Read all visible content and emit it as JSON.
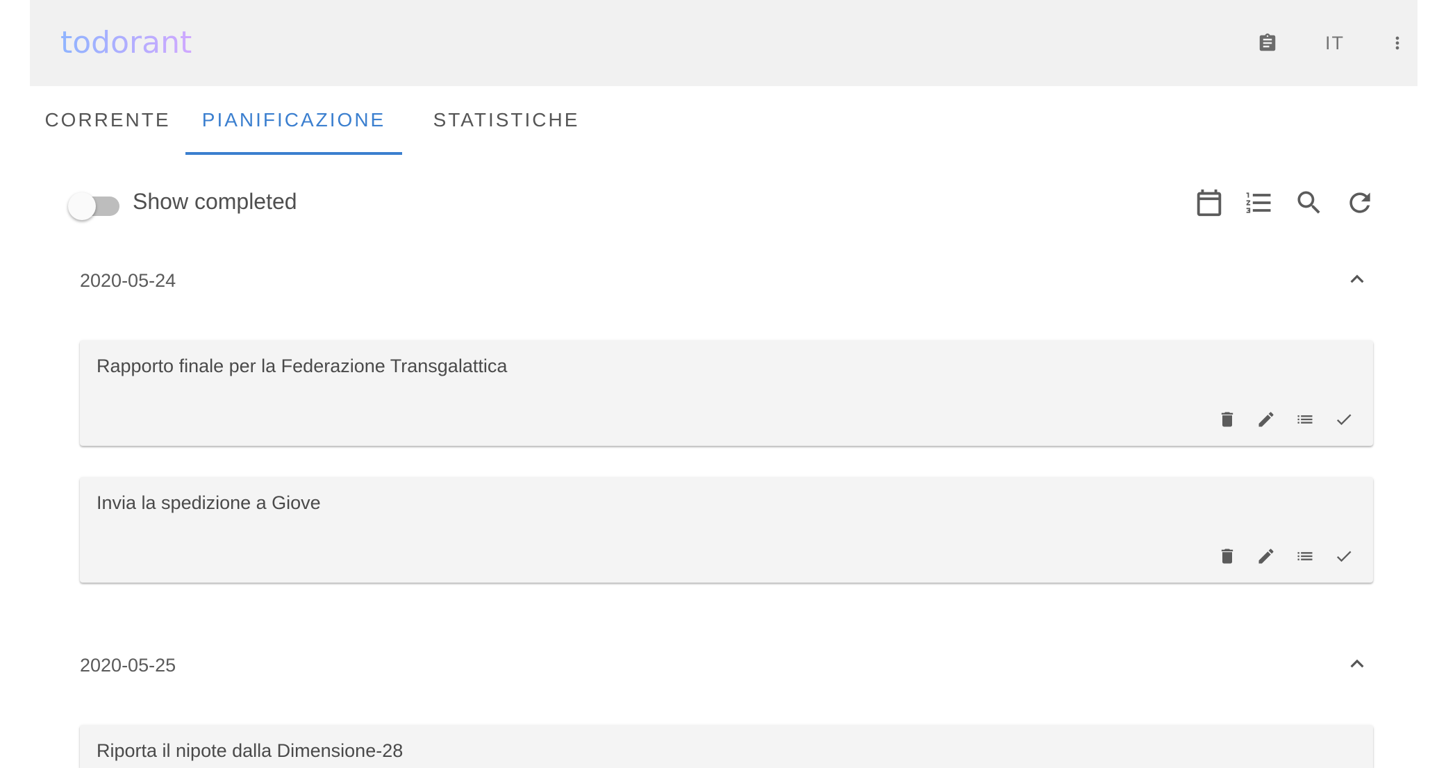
{
  "app": {
    "logo_text": "todorant",
    "language": "IT"
  },
  "tabs": [
    {
      "label": "Corrente",
      "active": false
    },
    {
      "label": "Pianificazione",
      "active": true
    },
    {
      "label": "Statistiche",
      "active": false
    }
  ],
  "toolbar": {
    "show_completed_label": "Show completed",
    "show_completed_value": false,
    "icons": [
      "calendar-icon",
      "numbered-list-icon",
      "search-icon",
      "refresh-icon"
    ]
  },
  "groups": [
    {
      "date": "2020-05-24",
      "expanded": true,
      "todos": [
        {
          "text": "Rapporto finale per la Federazione Transgalattica"
        },
        {
          "text": "Invia la spedizione a Giove"
        }
      ]
    },
    {
      "date": "2020-05-25",
      "expanded": true,
      "todos": [
        {
          "text": "Riporta il nipote dalla Dimensione-28"
        }
      ]
    }
  ],
  "colors": {
    "accent": "#3b7fcf",
    "appbar_bg": "#f1f1f1",
    "card_bg": "#f4f4f4",
    "icon": "#5b5b5b",
    "logo_gradient": [
      "#8fb4ff",
      "#c8a6ff"
    ]
  }
}
